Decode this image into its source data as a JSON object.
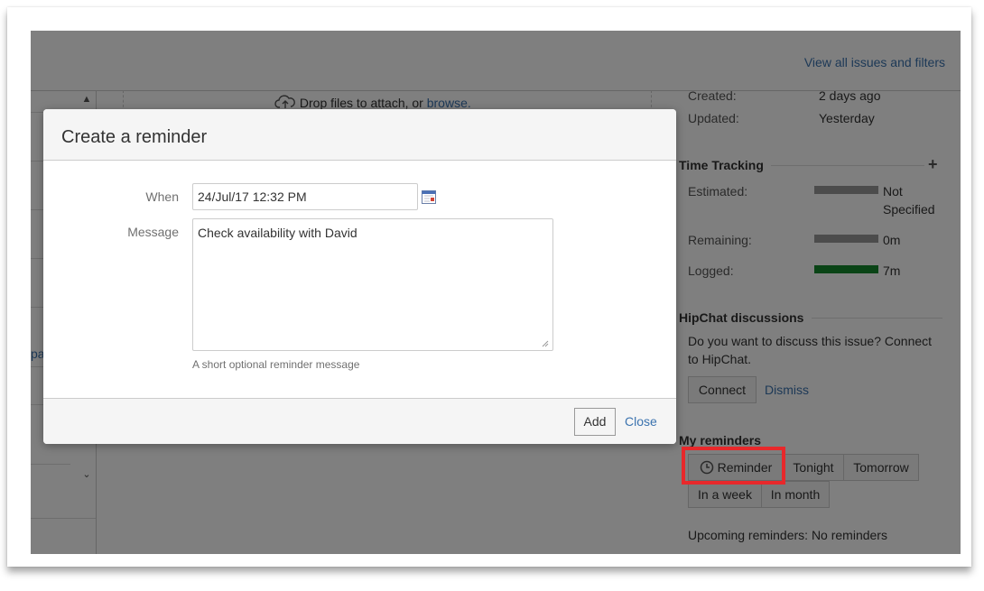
{
  "header": {
    "view_all_link": "View all issues and filters"
  },
  "drop_zone": {
    "text": "Drop files to attach, or ",
    "browse_link": "browse."
  },
  "left_panel": {
    "partial_link": "pa"
  },
  "dates": {
    "created_label": "Created:",
    "created_value": "2 days ago",
    "updated_label": "Updated:",
    "updated_value": "Yesterday"
  },
  "time_tracking": {
    "title": "Time Tracking",
    "add_icon": "+",
    "estimated_label": "Estimated:",
    "estimated_value_line1": "Not",
    "estimated_value_line2": "Specified",
    "remaining_label": "Remaining:",
    "remaining_value": "0m",
    "logged_label": "Logged:",
    "logged_value": "7m",
    "bar_color_empty": "#999999",
    "bar_color_logged": "#14892c",
    "logged_fraction": 1.0
  },
  "hipchat": {
    "title": "HipChat discussions",
    "prompt_line1": "Do you want to discuss this issue? Connect",
    "prompt_line2": "to HipChat.",
    "connect_label": "Connect",
    "dismiss_label": "Dismiss"
  },
  "reminders": {
    "title": "My reminders",
    "reminder_label": "Reminder",
    "tonight_label": "Tonight",
    "tomorrow_label": "Tomorrow",
    "week_label": "In a week",
    "month_label": "In month",
    "upcoming": "Upcoming reminders: No reminders"
  },
  "dialog": {
    "title": "Create a reminder",
    "when_label": "When",
    "when_value": "24/Jul/17 12:32 PM",
    "message_label": "Message",
    "message_value": "Check availability with David",
    "hint": "A short optional reminder message",
    "add_label": "Add",
    "close_label": "Close"
  },
  "icons": {
    "calendar": "calendar-icon",
    "clock": "clock-icon",
    "cloud_upload": "cloud-upload-icon",
    "scroll_up": "chevron-up-icon",
    "scroll_down": "chevron-down-icon",
    "resize": "resize-handle-icon"
  },
  "colors": {
    "highlight": "#e8282b",
    "link": "#3b73af",
    "overlay": "rgba(0,0,0,0.5)"
  }
}
